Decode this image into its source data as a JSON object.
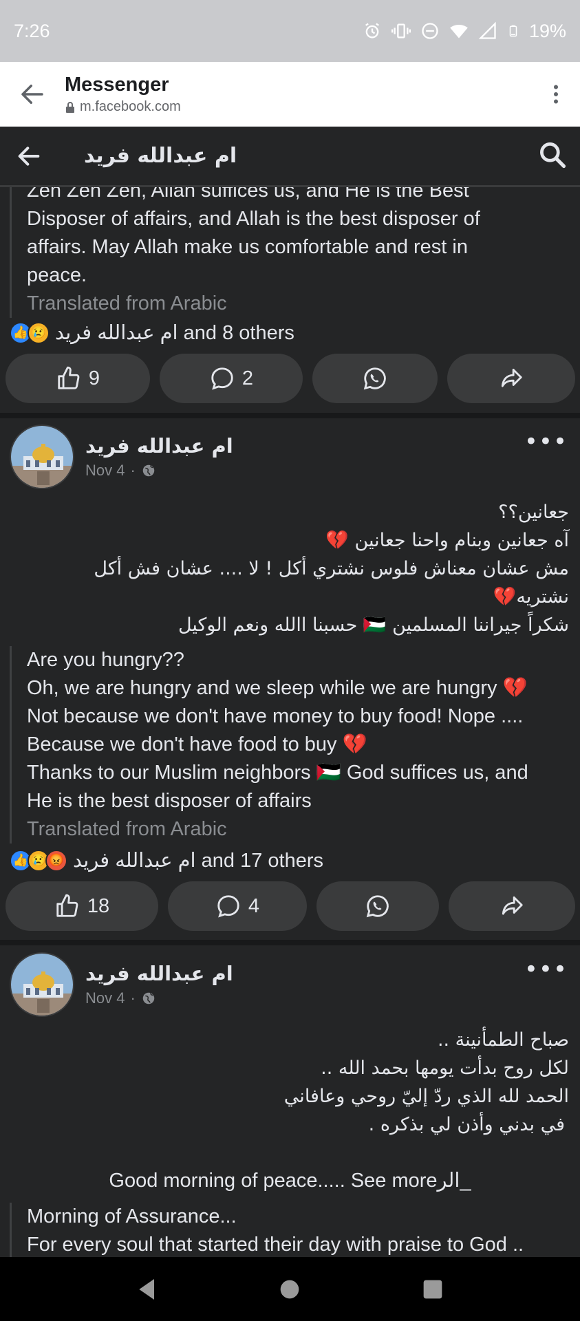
{
  "status_bar": {
    "time": "7:26",
    "battery": "19%"
  },
  "browser": {
    "title": "Messenger",
    "url": "m.facebook.com"
  },
  "chat_header": {
    "title": "ام عبدالله فريد"
  },
  "post0": {
    "translation_lines": [
      "Zen Zen Zen, Allah suffices us, and He is the Best",
      "Disposer of affairs, and Allah is the best disposer of",
      "affairs. May Allah make us comfortable and rest in",
      "peace."
    ],
    "translated_label": "Translated from Arabic",
    "reactions_text": "ام عبدالله فريد and 8 others",
    "like_count": "9",
    "comment_count": "2"
  },
  "post1": {
    "author": "ام عبدالله فريد",
    "date": "Nov 4",
    "arabic_lines": [
      "جعانين؟؟",
      "آه جعانين وبنام واحنا جعانين 💔",
      "مش عشان معناش فلوس نشتري أكل ! لا .... عشان فش أكل",
      "نشتريه💔",
      "شكراً جيراننا المسلمين 🇵🇸 حسبنا االله ونعم الوكيل"
    ],
    "translation_lines": [
      "Are you hungry??",
      "Oh, we are hungry and we sleep while we are hungry 💔",
      "Not because we don't have money to buy food! Nope ....",
      "Because we don't have food to buy 💔",
      "Thanks to our Muslim neighbors 🇵🇸 God suffices us, and",
      "He is the best disposer of affairs"
    ],
    "translated_label": "Translated from Arabic",
    "reactions_text": "ام عبدالله فريد and 17 others",
    "like_count": "18",
    "comment_count": "4"
  },
  "post2": {
    "author": "ام عبدالله فريد",
    "date": "Nov 4",
    "arabic_lines": [
      "صباح الطمأنينة ..",
      "لكل روح بدأت يومها بحمد الله ..",
      "الحمد لله الذي ردّ إليّ روحي وعافاني",
      "في بدني وأذن لي بذكره ."
    ],
    "see_more_line": "Good morning of peace..... See more",
    "see_more_tail": "الر_",
    "translation_lines": [
      "Morning of Assurance...",
      "For every soul that started their day with praise to God .."
    ]
  }
}
